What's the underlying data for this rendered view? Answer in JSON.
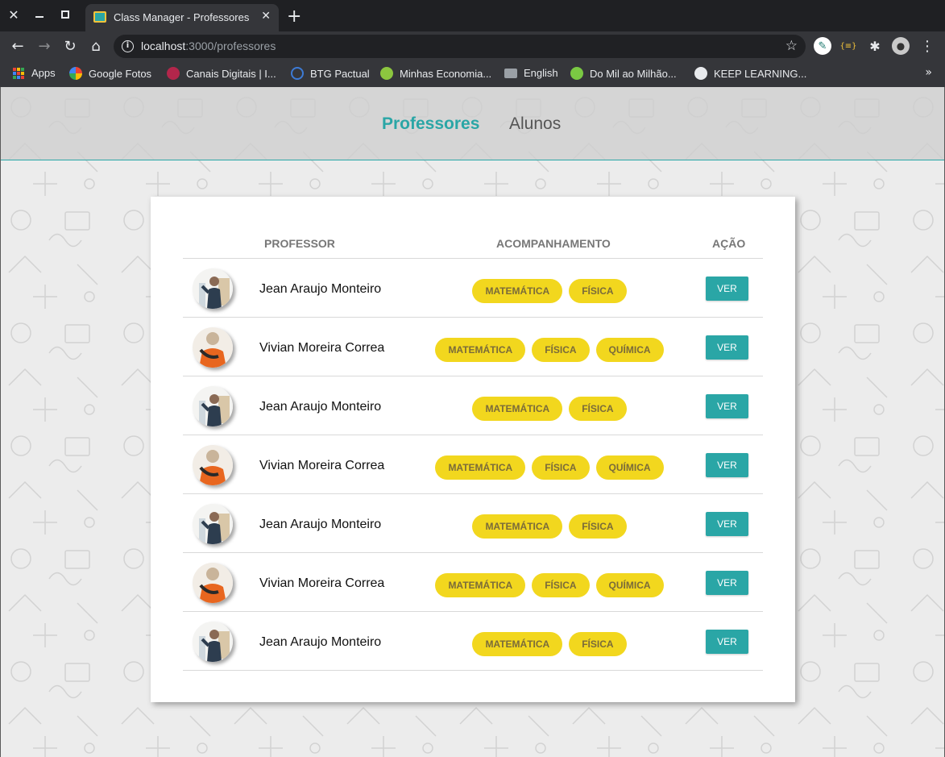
{
  "browser": {
    "tab_title": "Class Manager - Professores",
    "url_host": "localhost",
    "url_path": ":3000/professores",
    "bookmarks": [
      "Apps",
      "Google Fotos",
      "Canais Digitais | I...",
      "BTG Pactual",
      "Minhas Economia...",
      "English",
      "Do Mil ao Milhão...",
      "KEEP LEARNING..."
    ]
  },
  "nav": {
    "professores": "Professores",
    "alunos": "Alunos"
  },
  "table": {
    "headers": {
      "professor": "PROFESSOR",
      "acompanhamento": "ACOMPANHAMENTO",
      "acao": "AÇÃO"
    },
    "action_label": "VER",
    "rows": [
      {
        "name": "Jean Araujo Monteiro",
        "avatar": "male",
        "subjects": [
          "MATEMÁTICA",
          "FÍSICA"
        ]
      },
      {
        "name": "Vivian Moreira Correa",
        "avatar": "female",
        "subjects": [
          "MATEMÁTICA",
          "FÍSICA",
          "QUÍMICA"
        ]
      },
      {
        "name": "Jean Araujo Monteiro",
        "avatar": "male",
        "subjects": [
          "MATEMÁTICA",
          "FÍSICA"
        ]
      },
      {
        "name": "Vivian Moreira Correa",
        "avatar": "female",
        "subjects": [
          "MATEMÁTICA",
          "FÍSICA",
          "QUÍMICA"
        ]
      },
      {
        "name": "Jean Araujo Monteiro",
        "avatar": "male",
        "subjects": [
          "MATEMÁTICA",
          "FÍSICA"
        ]
      },
      {
        "name": "Vivian Moreira Correa",
        "avatar": "female",
        "subjects": [
          "MATEMÁTICA",
          "FÍSICA",
          "QUÍMICA"
        ]
      },
      {
        "name": "Jean Araujo Monteiro",
        "avatar": "male",
        "subjects": [
          "MATEMÁTICA",
          "FÍSICA"
        ]
      }
    ]
  },
  "colors": {
    "accent": "#2aa6a6",
    "badge": "#f2d71e",
    "badge_text": "#7a6b3a"
  }
}
